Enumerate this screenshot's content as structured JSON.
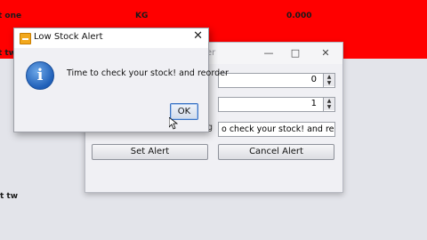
{
  "table": {
    "row1": {
      "c1": "t one",
      "c2": "KG",
      "c3": "0.000"
    },
    "row2_partial": "t tw",
    "row_under": "t tw"
  },
  "bg_dialog": {
    "title_tail": "er",
    "spinner1_value": "0",
    "spinner2_value": "1",
    "message_field_value": "o check your stock! and reorder",
    "set_alert_label": "Set Alert",
    "cancel_alert_label": "Cancel Alert",
    "label_fragment": "g"
  },
  "alert": {
    "title": "Low Stock Alert",
    "icon_letter": "i",
    "message": "Time to check your stock! and reorder",
    "ok_label": "OK"
  },
  "colors": {
    "table_highlight": "#ff0000",
    "ok_border": "#3a73c4"
  }
}
